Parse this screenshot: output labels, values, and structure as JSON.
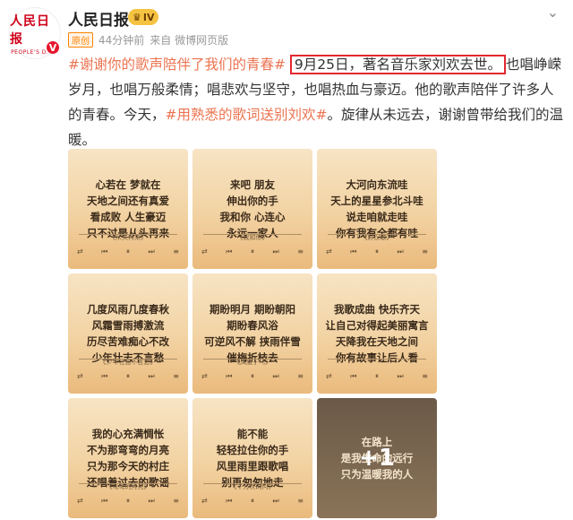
{
  "account": {
    "name": "人民日报",
    "avatar_text": "人民日报",
    "avatar_subtext": "PEOPLE'S DAILY",
    "verified_badge": "V",
    "member_label": "IV",
    "member_icon": "crown-icon"
  },
  "meta": {
    "tag": "原创",
    "time": "44分钟前",
    "source": "来自 微博网页版"
  },
  "post": {
    "topic1": "#谢谢你的歌声陪伴了我们的青春#",
    "boxed": "9月25日，著名音乐家刘欢去世。",
    "text1": "也唱峥嵘岁月，也唱万般柔情；唱悲欢与坚守，也唱热血与豪迈。他的歌声陪伴了许多人的青春。今天，",
    "topic2": "#用熟悉的歌词送别刘欢#",
    "text2": "。旋律从未远去，谢谢曾带给我们的温暖。"
  },
  "tiles": [
    {
      "lines": [
        "心若在 梦就在",
        "天地之间还有真爱",
        "看成败 人生豪迈",
        "只不过是从头再来"
      ],
      "song": "《从头再来》"
    },
    {
      "lines": [
        "来吧 朋友",
        "伸出你的手",
        "我和你 心连心",
        "永远一家人"
      ],
      "song": "《我和你》"
    },
    {
      "lines": [
        "大河向东流哇",
        "天上的星星参北斗哇",
        "说走咱就走哇",
        "你有我有全都有哇"
      ],
      "song": "《好汉歌》"
    },
    {
      "lines": [
        "几度风雨几度春秋",
        "风霜雪雨搏激流",
        "历尽苦难痴心不改",
        "少年壮志不言愁"
      ],
      "song": "《少年壮志不言愁》"
    },
    {
      "lines": [
        "期盼明月 期盼朝阳",
        "期盼春风浴",
        "可逆风不解 挟雨伴雪",
        "催梅折枝去"
      ],
      "song": "《凤凰于飞》"
    },
    {
      "lines": [
        "我歌成曲 快乐齐天",
        "让自己对得起美丽寓言",
        "天降我在天地之间",
        "你有故事让后人看"
      ],
      "song": ""
    },
    {
      "lines": [
        "我的心充满惆怅",
        "不为那弯弯的月亮",
        "只为那今天的村庄",
        "还唱着过去的歌谣"
      ],
      "song": "《弯弯的月亮》"
    },
    {
      "lines": [
        "能不能",
        "轻轻拉住你的手",
        "风里雨里跟歌唱",
        "别再匆匆地走"
      ],
      "song": "《千万次的问》"
    },
    {
      "lines": [
        "在路上",
        "是我生命的远行",
        "只为温暖我的人"
      ],
      "song": "",
      "more": "+1"
    }
  ]
}
